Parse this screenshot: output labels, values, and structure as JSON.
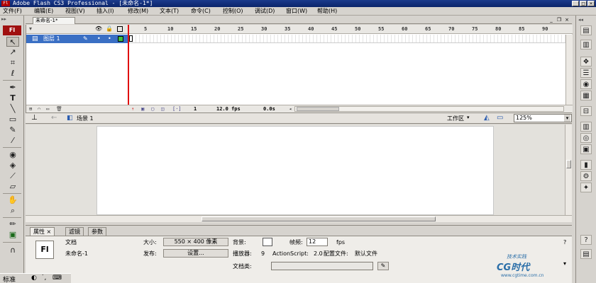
{
  "window": {
    "title": "Adobe Flash CS3 Professional - [未命名-1*]",
    "logo": "Fl",
    "controls": [
      "_",
      "□",
      "×"
    ]
  },
  "menu": [
    "文件(F)",
    "编辑(E)",
    "视图(V)",
    "插入(I)",
    "修改(M)",
    "文本(T)",
    "命令(C)",
    "控制(O)",
    "调试(D)",
    "窗口(W)",
    "帮助(H)"
  ],
  "toolbox": {
    "logo": "Fl",
    "tools": [
      {
        "icon": "arrow-icon",
        "glyph": "↖"
      },
      {
        "icon": "subselect-icon",
        "glyph": "↗"
      },
      {
        "icon": "free-transform-icon",
        "glyph": "⌗"
      },
      {
        "icon": "lasso-icon",
        "glyph": "ℓ"
      },
      {
        "icon": "pen-icon",
        "glyph": "✒"
      },
      {
        "icon": "text-icon",
        "glyph": "T"
      },
      {
        "icon": "line-icon",
        "glyph": "╲"
      },
      {
        "icon": "rectangle-icon",
        "glyph": "▭"
      },
      {
        "icon": "pencil-icon",
        "glyph": "✎"
      },
      {
        "icon": "brush-icon",
        "glyph": "⁄"
      },
      {
        "icon": "ink-bottle-icon",
        "glyph": "◉"
      },
      {
        "icon": "paint-bucket-icon",
        "glyph": "◈"
      },
      {
        "icon": "eyedropper-icon",
        "glyph": "⟋"
      },
      {
        "icon": "eraser-icon",
        "glyph": "▱"
      },
      {
        "icon": "hand-icon",
        "glyph": "✋"
      },
      {
        "icon": "zoom-icon",
        "glyph": "⌕"
      },
      {
        "icon": "stroke-color-icon",
        "glyph": "✏"
      },
      {
        "icon": "fill-color-icon",
        "glyph": "▣"
      },
      {
        "icon": "snap-icon",
        "glyph": "∩"
      }
    ]
  },
  "document": {
    "tab": "未命名-1*",
    "doc_controls": [
      "_",
      "❐",
      "×"
    ]
  },
  "timeline": {
    "frame_numbers": [
      "5",
      "10",
      "15",
      "20",
      "25",
      "30",
      "35",
      "40",
      "45",
      "50",
      "55",
      "60",
      "65",
      "70",
      "75",
      "80",
      "85",
      "90"
    ],
    "layer": "图层 1",
    "footer_frame": "1",
    "footer_fps": "12.0 fps",
    "footer_time": "0.0s"
  },
  "editbar": {
    "scene": "场景 1",
    "workspace": "工作区",
    "zoom": "125%"
  },
  "properties": {
    "tabs": [
      "属性",
      "滤镜",
      "参数"
    ],
    "doc_type_icon": "Fl",
    "doc_label": "文档",
    "doc_name": "未命名-1",
    "size_label": "大小:",
    "size_value": "550 × 400 像素",
    "publish_label": "发布:",
    "settings_btn": "设置...",
    "bg_label": "背景:",
    "fps_label": "帧频:",
    "fps_value": "12",
    "fps_unit": "fps",
    "player_label": "播放器:",
    "player_value": "9",
    "as_label": "ActionScript:",
    "as_value": "2.0",
    "profile_label": "配置文件:",
    "profile_value": "默认文件",
    "class_label": "文档类:",
    "watermark_top": "技术实践",
    "watermark_brand": "CG时代",
    "watermark_url": "www.cgtime.com.cn"
  },
  "bottombar": {
    "ime": "标准"
  }
}
